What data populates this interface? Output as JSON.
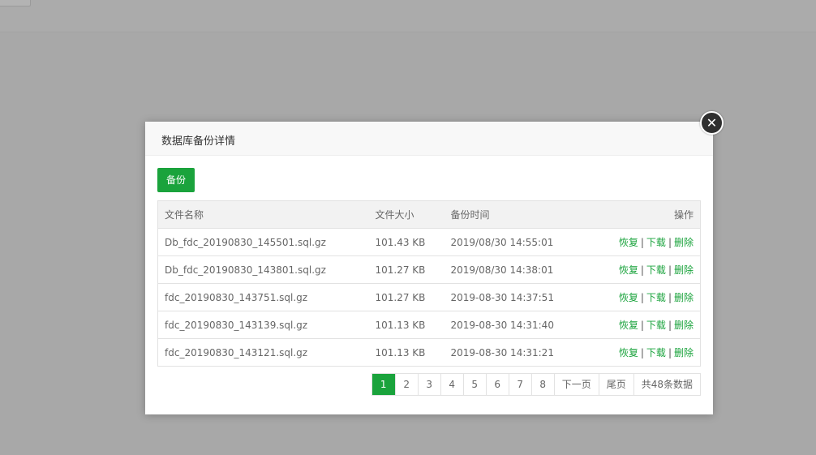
{
  "modal": {
    "title": "数据库备份详情",
    "backup_label": "备份"
  },
  "table": {
    "headers": {
      "name": "文件名称",
      "size": "文件大小",
      "time": "备份时间",
      "ops": "操作"
    },
    "rows": [
      {
        "name": "Db_fdc_20190830_145501.sql.gz",
        "size": "101.43 KB",
        "time": "2019/08/30 14:55:01"
      },
      {
        "name": "Db_fdc_20190830_143801.sql.gz",
        "size": "101.27 KB",
        "time": "2019/08/30 14:38:01"
      },
      {
        "name": "fdc_20190830_143751.sql.gz",
        "size": "101.27 KB",
        "time": "2019-08-30 14:37:51"
      },
      {
        "name": "fdc_20190830_143139.sql.gz",
        "size": "101.13 KB",
        "time": "2019-08-30 14:31:40"
      },
      {
        "name": "fdc_20190830_143121.sql.gz",
        "size": "101.13 KB",
        "time": "2019-08-30 14:31:21"
      }
    ],
    "actions": {
      "restore": "恢复",
      "download": "下载",
      "delete": "删除",
      "sep": "|"
    }
  },
  "pagination": {
    "pages": [
      "1",
      "2",
      "3",
      "4",
      "5",
      "6",
      "7",
      "8"
    ],
    "current": "1",
    "next": "下一页",
    "last": "尾页",
    "total": "共48条数据"
  },
  "icons": {
    "close": "close-icon"
  },
  "colors": {
    "accent": "#1aa33c"
  }
}
